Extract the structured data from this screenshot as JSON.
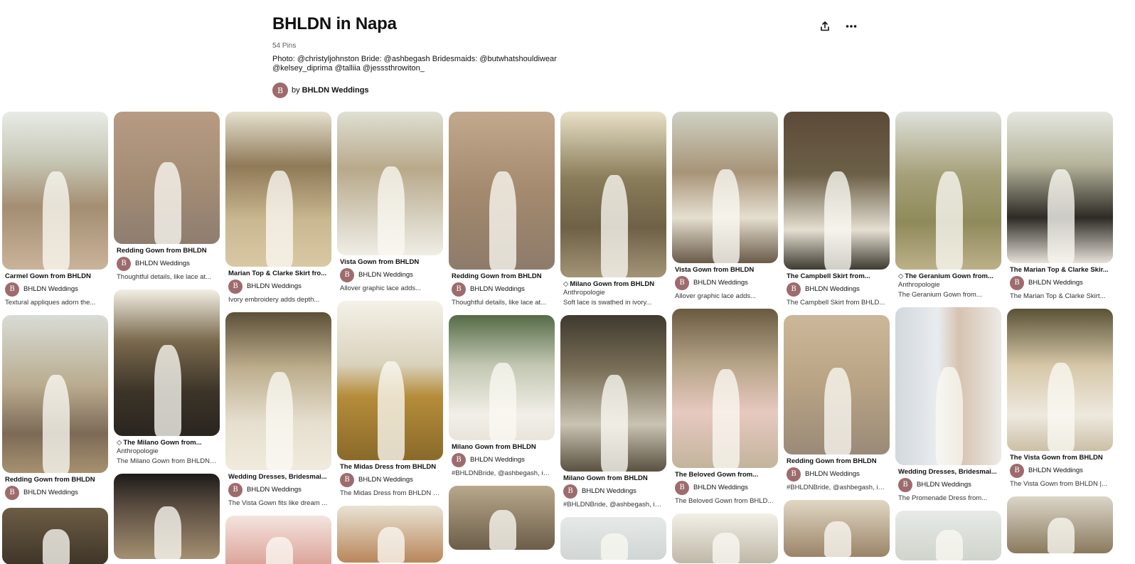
{
  "board": {
    "title": "BHLDN in Napa",
    "pin_count": "54 Pins",
    "description": "Photo: @christyljohnston Bride: @ashbegash Bridesmaids: @butwhatshouldiwear @kelsey_diprima @talliia @jesssthrowiton_",
    "owner_prefix": "by",
    "owner_name": "BHLDN Weddings",
    "owner_initial": "B"
  },
  "icons": {
    "share": "share-icon",
    "more": "more-options-icon"
  },
  "colors": {
    "avatar": "#9e6b6d",
    "text": "#111111"
  },
  "columns": [
    {
      "pins": [
        {
          "title": "Carmel Gown from BHLDN",
          "creator": "BHLDN Weddings",
          "note": "Textural appliques adorn the...",
          "img_h": 222,
          "bg": "linear-gradient(180deg,#e8ebe6 0%,#c8c9b8 30%,#a48e72 60%,#c9b39a 100%)"
        },
        {
          "title": "Redding Gown from BHLDN",
          "creator": "BHLDN Weddings",
          "img_h": 222,
          "bg": "linear-gradient(180deg,#d8dcd6 0%,#b9ab8e 45%,#7c6a56 75%,#a6916f 100%)"
        },
        {
          "title": "",
          "img_h": 80,
          "bg": "linear-gradient(180deg,#6c5d45 0%,#3f3528 100%)"
        }
      ]
    },
    {
      "pins": [
        {
          "title": "Redding Gown from BHLDN",
          "creator": "BHLDN Weddings",
          "note": "Thoughtful details, like lace at...",
          "img_h": 186,
          "bg": "linear-gradient(180deg,#b79b82 0%,#a38c74 55%,#8e7d70 100%)"
        },
        {
          "tag": true,
          "title": "The Milano Gown from...",
          "sub": "Anthropologie",
          "note": "The Milano Gown from BHLDN ...",
          "img_h": 206,
          "bg": "linear-gradient(180deg,#f3efe4 0%,#7a6a4e 35%,#3c3428 70%,#2a2520 100%)"
        },
        {
          "title": "",
          "img_h": 120,
          "bg": "linear-gradient(180deg,#1d1b19 0%,#5d4f42 40%,#a49071 100%)"
        }
      ]
    },
    {
      "pins": [
        {
          "title": "Marian Top & Clarke Skirt fro...",
          "creator": "BHLDN Weddings",
          "note": "Ivory embroidery adds depth...",
          "img_h": 218,
          "bg": "linear-gradient(180deg,#e6e1cf 0%,#8f7a58 35%,#c9b890 70%,#d9c8a4 100%)"
        },
        {
          "title": "Wedding Dresses, Bridesmai...",
          "creator": "BHLDN Weddings",
          "note": "The Vista Gown fits like dream ...",
          "img_h": 222,
          "bg": "linear-gradient(180deg,#5c5037 0%,#bcad8c 35%,#e6dfcf 70%,#f0ebde 100%)"
        },
        {
          "title": "",
          "img_h": 80,
          "bg": "linear-gradient(180deg,#f4e4df 0%,#d89a8e 100%)"
        }
      ]
    },
    {
      "pins": [
        {
          "title": "Vista Gown from BHLDN",
          "creator": "BHLDN Weddings",
          "note": "Allover graphic lace adds...",
          "img_h": 202,
          "bg": "linear-gradient(180deg,#dfe0d3 0%,#b8a98a 40%,#d8d2c2 75%,#f0ede5 100%)"
        },
        {
          "title": "The Midas Dress from BHLDN",
          "creator": "BHLDN Weddings",
          "note": "The Midas Dress from BHLDN |...",
          "img_h": 224,
          "bg": "linear-gradient(180deg,#f4f1e8 0%,#d9d2bc 40%,#b58c3a 60%,#8a6a2a 100%)"
        },
        {
          "title": "",
          "img_h": 80,
          "bg": "linear-gradient(180deg,#e9e3d4 0%,#b9865a 100%)"
        }
      ]
    },
    {
      "pins": [
        {
          "title": "Redding Gown from BHLDN",
          "creator": "BHLDN Weddings",
          "note": "Thoughtful details, like lace at...",
          "img_h": 222,
          "bg": "linear-gradient(180deg,#c2a88c 0%,#a48a6e 50%,#8d7b6a 100%)"
        },
        {
          "title": "Milano Gown from BHLDN",
          "creator": "BHLDN Weddings",
          "note": "#BHLDNBride, @ashbegash, in...",
          "img_h": 176,
          "bg": "linear-gradient(180deg,#556b47 0%,#c2c7b2 40%,#f2efe8 80%,#e8e4da 100%)"
        },
        {
          "title": "",
          "img_h": 90,
          "bg": "linear-gradient(180deg,#b8a88b 0%,#6b5d48 100%)"
        }
      ]
    },
    {
      "pins": [
        {
          "tag": true,
          "title": "Milano Gown from BHLDN",
          "sub": "Anthropologie",
          "note": "Soft lace is swathed in ivory...",
          "img_h": 233,
          "bg": "linear-gradient(180deg,#e8e0c8 0%,#8a7d5a 40%,#6e6146 70%,#a39477 100%)"
        },
        {
          "title": "Milano Gown from BHLDN",
          "creator": "BHLDN Weddings",
          "note": "#BHLDNBride, @ashbegash, in...",
          "img_h": 220,
          "bg": "linear-gradient(180deg,#3f3a2e 0%,#7a6f58 35%,#c9c3b3 70%,#5a5140 100%)"
        },
        {
          "title": "",
          "img_h": 60,
          "bg": "linear-gradient(180deg,#e6e9e8 0%,#d0d6d4 100%)"
        }
      ]
    },
    {
      "pins": [
        {
          "title": "Vista Gown from BHLDN",
          "creator": "BHLDN Weddings",
          "note": "Allover graphic lace adds...",
          "img_h": 213,
          "bg": "linear-gradient(180deg,#cfd1c3 0%,#a89478 40%,#e5dfd0 70%,#6a5a48 100%)"
        },
        {
          "title": "The Beloved Gown from...",
          "creator": "BHLDN Weddings",
          "note": "The Beloved Gown from BHLD...",
          "img_h": 224,
          "bg": "linear-gradient(180deg,#6a5b40 0%,#b6a488 35%,#e7c9c0 65%,#c3b49c 100%)"
        },
        {
          "title": "",
          "img_h": 70,
          "bg": "linear-gradient(180deg,#f2efe6 0%,#bfb8a8 100%)"
        }
      ]
    },
    {
      "pins": [
        {
          "title": "The Campbell Skirt from...",
          "creator": "BHLDN Weddings",
          "note": "The Campbell Skirt from BHLD...",
          "img_h": 222,
          "bg": "linear-gradient(180deg,#5c4a38 0%,#6c6048 40%,#e5dfd2 75%,#3d3a30 100%)"
        },
        {
          "title": "Redding Gown from BHLDN",
          "creator": "BHLDN Weddings",
          "note": "#BHLDNBride, @ashbegash, in...",
          "img_h": 196,
          "bg": "linear-gradient(180deg,#cdb79a 0%,#b8a384 50%,#9a8a78 100%)"
        },
        {
          "title": "",
          "img_h": 80,
          "bg": "linear-gradient(180deg,#e1d7c4 0%,#9a8468 100%)"
        }
      ]
    },
    {
      "pins": [
        {
          "tag": true,
          "title": "The Geranium Gown from...",
          "sub": "Anthropologie",
          "note": "The Geranium Gown from...",
          "img_h": 222,
          "bg": "linear-gradient(180deg,#dfe2dc 0%,#a6a07a 40%,#8f8a5a 70%,#bdb08a 100%)"
        },
        {
          "title": "Wedding Dresses, Bridesmai...",
          "creator": "BHLDN Weddings",
          "note": "The Promenade Dress from...",
          "img_h": 222,
          "bg": "linear-gradient(90deg,#d2d8dd 0%,#e9ecef 40%,#d6c2b0 60%,#eceae6 100%)"
        },
        {
          "title": "",
          "img_h": 70,
          "bg": "linear-gradient(180deg,#e7eae6 0%,#cfd4cc 100%)"
        }
      ]
    },
    {
      "pins": [
        {
          "title": "The Marian Top & Clarke Skir...",
          "creator": "BHLDN Weddings",
          "note": "The Marian Top & Clarke Skirt...",
          "img_h": 213,
          "bg": "linear-gradient(180deg,#e5e7e0 0%,#b5b49a 35%,#2e2a26 70%,#e6e2d8 100%)"
        },
        {
          "title": "The Vista Gown from BHLDN",
          "creator": "BHLDN Weddings",
          "note": "The Vista Gown from BHLDN |...",
          "img_h": 200,
          "bg": "linear-gradient(180deg,#5a5236 0%,#d6c7a8 40%,#eee9df 75%,#cbbfa6 100%)"
        },
        {
          "title": "",
          "img_h": 80,
          "bg": "linear-gradient(180deg,#dcd6c8 0%,#8a7a5e 100%)"
        }
      ]
    }
  ]
}
